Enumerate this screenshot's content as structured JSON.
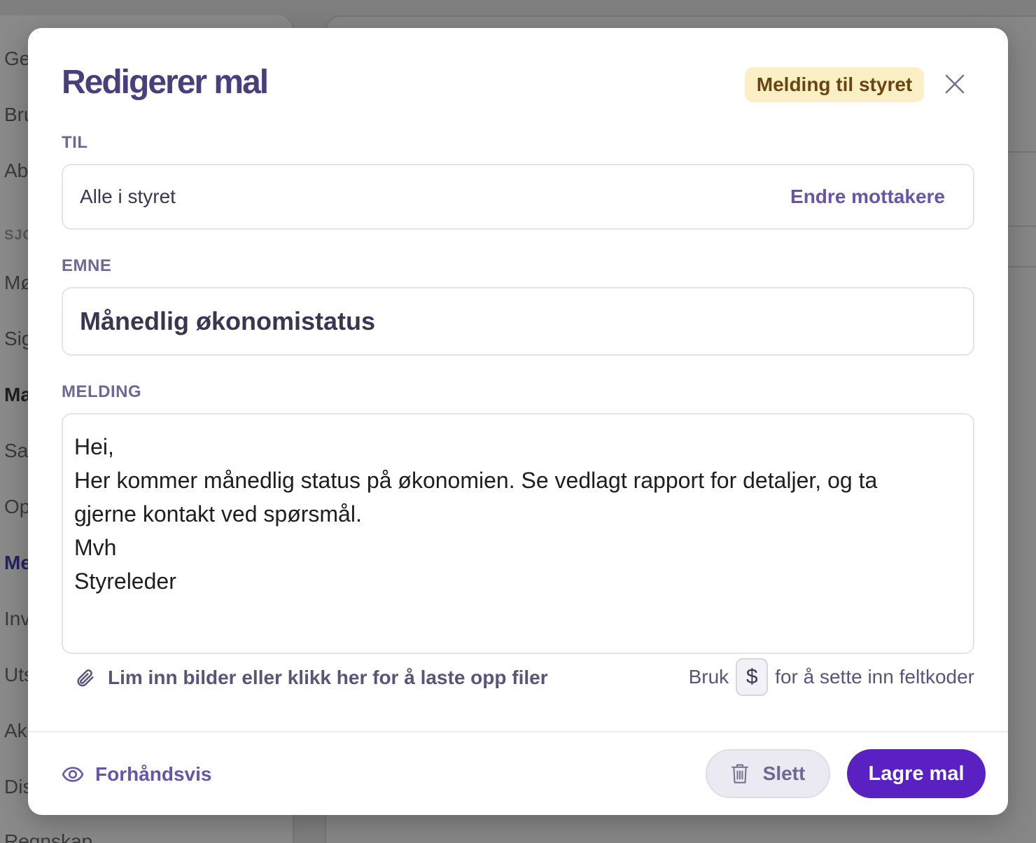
{
  "background": {
    "sidebar_items": [
      {
        "label": "Ge",
        "style": "normal"
      },
      {
        "label": "Bru",
        "style": "normal"
      },
      {
        "label": "Ab",
        "style": "normal"
      },
      {
        "label": "SJO",
        "style": "section"
      },
      {
        "label": "Mø",
        "style": "normal"
      },
      {
        "label": "Sig",
        "style": "normal"
      },
      {
        "label": "Ma",
        "style": "strong"
      },
      {
        "label": "Sa",
        "style": "normal"
      },
      {
        "label": "Op",
        "style": "normal"
      },
      {
        "label": "Me",
        "style": "active"
      },
      {
        "label": "Inv",
        "style": "normal"
      },
      {
        "label": "Uts",
        "style": "normal"
      },
      {
        "label": "Ak",
        "style": "normal"
      },
      {
        "label": "Dis",
        "style": "normal"
      },
      {
        "label": "Regnskap",
        "style": "normal"
      }
    ]
  },
  "modal": {
    "title": "Redigerer mal",
    "badge": "Melding til styret",
    "close_icon": "close-icon",
    "to": {
      "label": "TIL",
      "value": "Alle i styret",
      "change_link": "Endre mottakere"
    },
    "subject": {
      "label": "EMNE",
      "value": "Månedlig økonomistatus"
    },
    "message": {
      "label": "MELDING",
      "lines": [
        "Hei,",
        "Her kommer månedlig status på økonomien. Se vedlagt rapport for detaljer, og ta",
        "gjerne kontakt ved spørsmål.",
        "Mvh",
        "Styreleder"
      ]
    },
    "attachments": {
      "icon": "paperclip-icon",
      "text": "Lim inn bilder eller klikk her for å laste opp filer"
    },
    "field_code_hint": {
      "prefix": "Bruk",
      "key": "$",
      "suffix": "for å sette inn feltkoder"
    },
    "footer": {
      "preview_icon": "eye-icon",
      "preview_label": "Forhåndsvis",
      "delete_icon": "trash-icon",
      "delete_label": "Slett",
      "save_label": "Lagre mal"
    }
  },
  "colors": {
    "title": "#4a3f7c",
    "accent_link": "#6a54a8",
    "primary_button": "#5b20c2",
    "badge_bg": "#fbf0c5",
    "badge_text": "#6b4511",
    "overlay": "#7f7f7f"
  }
}
